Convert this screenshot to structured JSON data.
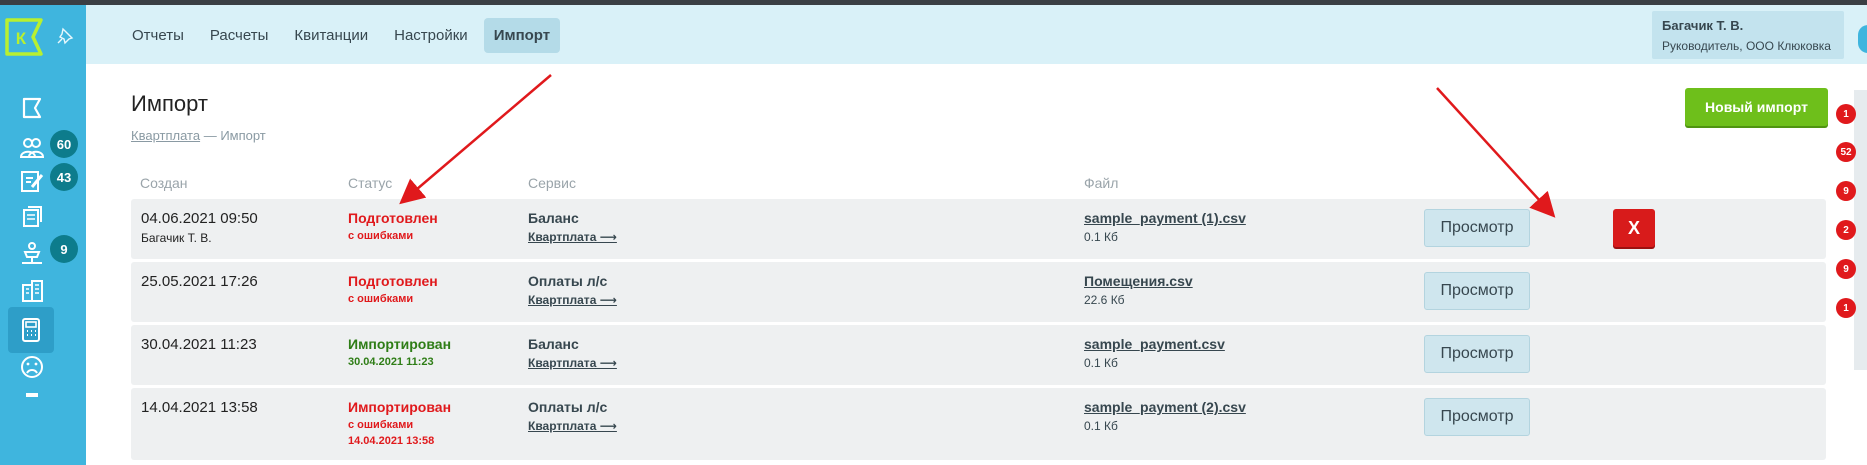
{
  "sidebar": {
    "logo_letter": "К",
    "counts": {
      "residents": "60",
      "requests": "43",
      "payments": "9"
    }
  },
  "header": {
    "tabs": [
      {
        "label": "Отчеты"
      },
      {
        "label": "Расчеты"
      },
      {
        "label": "Квитанции"
      },
      {
        "label": "Настройки"
      },
      {
        "label": "Импорт",
        "active": true
      }
    ],
    "user": {
      "name": "Багачик Т. В.",
      "role": "Руководитель, ООО Клюковка"
    }
  },
  "page": {
    "title": "Импорт",
    "breadcrumb": {
      "root": "Квартплата",
      "sep": " — ",
      "current": "Импорт"
    },
    "new_import_label": "Новый импорт"
  },
  "table": {
    "columns": {
      "created": "Создан",
      "status": "Статус",
      "service": "Сервис",
      "file": "Файл"
    },
    "view_label": "Просмотр",
    "delete_label": "X",
    "rows": [
      {
        "created": "04.06.2021 09:50",
        "author": "Багачик Т. В.",
        "status": "Подготовлен",
        "status_type": "err",
        "status_sub": "с ошибками",
        "status_sub2": "",
        "service": "Баланс",
        "service_link": "Квартплата ⟶",
        "file": "sample_payment (1).csv",
        "size": "0.1 Кб",
        "deletable": true
      },
      {
        "created": "25.05.2021 17:26",
        "author": "",
        "status": "Подготовлен",
        "status_type": "err",
        "status_sub": "с ошибками",
        "status_sub2": "",
        "service": "Оплаты л/с",
        "service_link": "Квартплата ⟶",
        "file": "Помещения.csv",
        "size": "22.6 Кб",
        "deletable": false
      },
      {
        "created": "30.04.2021 11:23",
        "author": "",
        "status": "Импортирован",
        "status_type": "ok",
        "status_sub": "30.04.2021 11:23",
        "status_sub2": "",
        "service": "Баланс",
        "service_link": "Квартплата ⟶",
        "file": "sample_payment.csv",
        "size": "0.1 Кб",
        "deletable": false
      },
      {
        "created": "14.04.2021 13:58",
        "author": "",
        "status": "Импортирован",
        "status_type": "err",
        "status_sub": "с ошибками",
        "status_sub2": "14.04.2021 13:58",
        "service": "Оплаты л/с",
        "service_link": "Квартплата ⟶",
        "file": "sample_payment (2).csv",
        "size": "0.1 Кб",
        "deletable": false
      }
    ]
  },
  "right_panel": {
    "badges": [
      "1",
      "52",
      "9",
      "2",
      "9",
      "1"
    ]
  },
  "colors": {
    "sidebar": "#3fb5de",
    "header": "#d9f1f8",
    "accent_green": "#6ebf1b",
    "error_red": "#e0191c",
    "ok_green": "#2e7d16"
  }
}
